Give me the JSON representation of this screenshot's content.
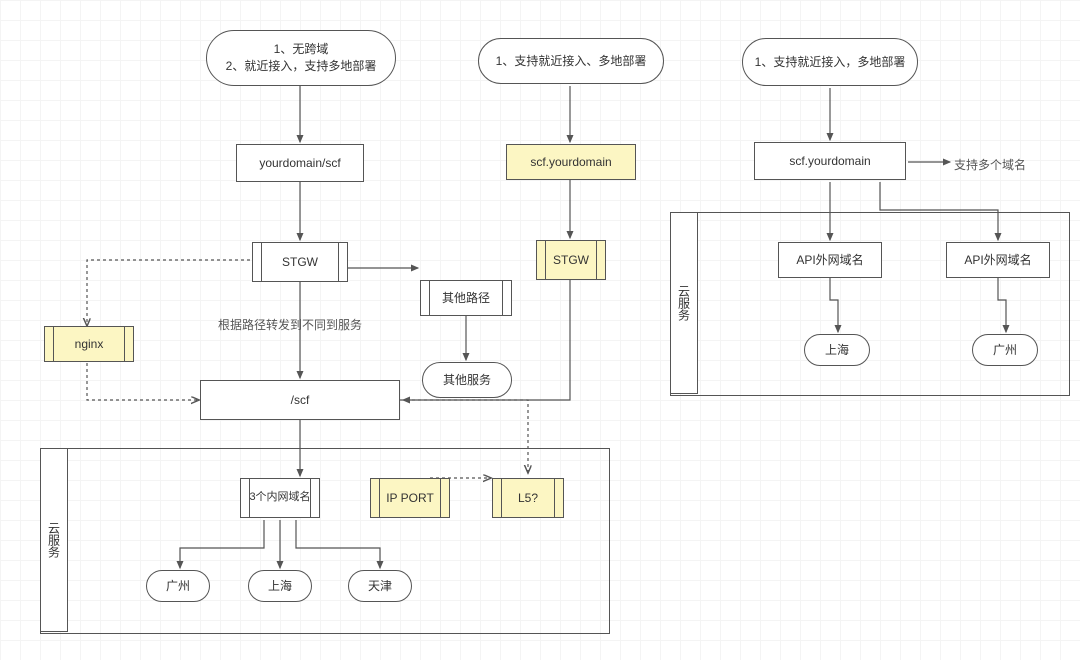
{
  "columnA": {
    "start": {
      "line1": "1、无跨域",
      "line2": "2、就近接入，支持多地部署"
    },
    "domain": "yourdomain/scf",
    "stgw": "STGW",
    "scfPath": "/scf",
    "otherRoute": "其他路径",
    "otherService": "其他服务",
    "nginx": "nginx",
    "routeText": "根据路径转发到不同到服务",
    "package": "云服务",
    "internal": "3个内网域名",
    "ipport": "IP PORT",
    "l5": "L5?",
    "gz": "广州",
    "sh": "上海",
    "tj": "天津"
  },
  "columnB": {
    "start": "1、支持就近接入、多地部署",
    "domain": "scf.yourdomain",
    "stgw": "STGW"
  },
  "columnC": {
    "start": "1、支持就近接入，多地部署",
    "domain": "scf.yourdomain",
    "multi": "支持多个域名",
    "package": "云服务",
    "api1": "API外网域名",
    "api2": "API外网域名",
    "sh": "上海",
    "gz": "广州"
  }
}
